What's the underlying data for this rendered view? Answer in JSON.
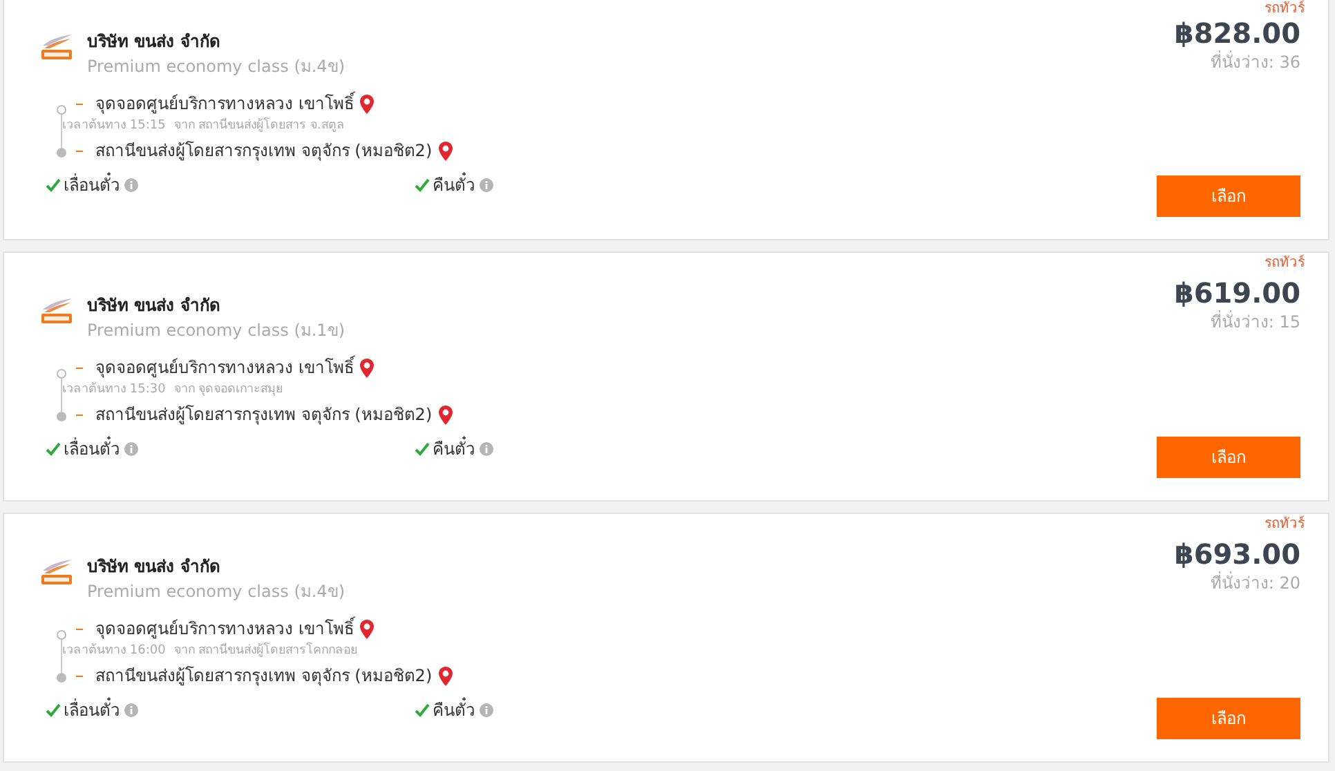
{
  "trips": [
    {
      "tag": "รถทัวร์",
      "company": "บริษัท ขนส่ง จำกัด",
      "bus_class": "Premium economy class (ม.4ข)",
      "stops": [
        {
          "kind": "boarding",
          "name": "จุดจอดศูนย์บริการทางหลวง เขาโพธิ์",
          "departure": "เวลาต้นทาง 15:15",
          "origin": "จาก สถานีขนส่งผู้โดยสาร จ.สตูล"
        },
        {
          "kind": "dropoff",
          "name": "สถานีขนส่งผู้โดยสารกรุงเทพ จตุจักร (หมอชิต2)"
        }
      ],
      "features": [
        {
          "label": "เลื่อนตั๋ว",
          "available": true
        },
        {
          "label": "คืนตั๋ว",
          "available": true
        }
      ],
      "price": "฿828.00",
      "seats": "ที่นั่งว่าง: 36",
      "button": "เลือก"
    },
    {
      "tag": "รถทัวร์",
      "company": "บริษัท ขนส่ง จำกัด",
      "bus_class": "Premium economy class (ม.1ข)",
      "stops": [
        {
          "kind": "boarding",
          "name": "จุดจอดศูนย์บริการทางหลวง เขาโพธิ์",
          "departure": "เวลาต้นทาง 15:30",
          "origin": "จาก จุดจอดเกาะสมุย"
        },
        {
          "kind": "dropoff",
          "name": "สถานีขนส่งผู้โดยสารกรุงเทพ จตุจักร (หมอชิต2)"
        }
      ],
      "features": [
        {
          "label": "เลื่อนตั๋ว",
          "available": true
        },
        {
          "label": "คืนตั๋ว",
          "available": true
        }
      ],
      "price": "฿619.00",
      "seats": "ที่นั่งว่าง: 15",
      "button": "เลือก"
    },
    {
      "tag": "รถทัวร์",
      "company": "บริษัท ขนส่ง จำกัด",
      "bus_class": "Premium economy class (ม.4ข)",
      "stops": [
        {
          "kind": "boarding",
          "name": "จุดจอดศูนย์บริการทางหลวง เขาโพธิ์",
          "departure": "เวลาต้นทาง 16:00",
          "origin": "จาก สถานีขนส่งผู้โดยสารโคกกลอย"
        },
        {
          "kind": "dropoff",
          "name": "สถานีขนส่งผู้โดยสารกรุงเทพ จตุจักร (หมอชิต2)"
        }
      ],
      "features": [
        {
          "label": "เลื่อนตั๋ว",
          "available": true
        },
        {
          "label": "คืนตั๋ว",
          "available": true
        }
      ],
      "price": "฿693.00",
      "seats": "ที่นั่งว่าง: 20",
      "button": "เลือก"
    }
  ]
}
